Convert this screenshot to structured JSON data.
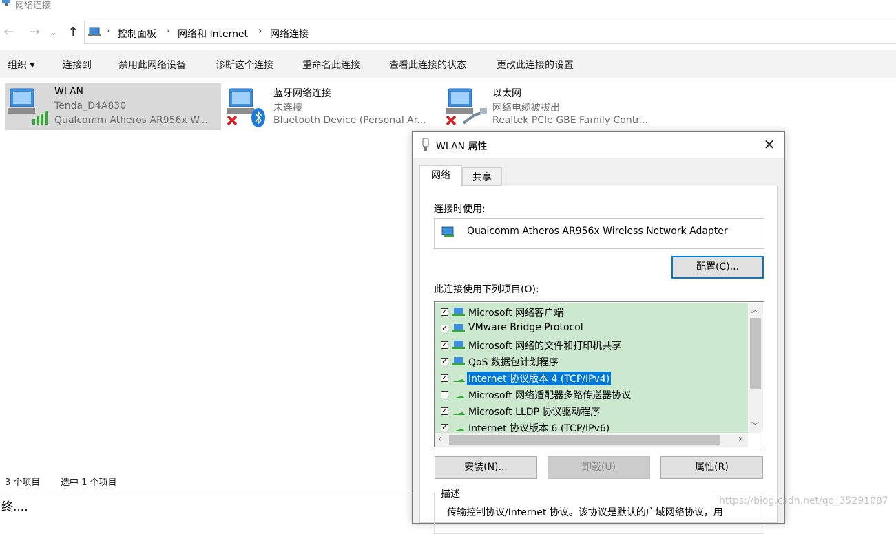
{
  "window": {
    "title": "网络连接"
  },
  "nav": {
    "back": "←",
    "forward": "→",
    "up": "↑"
  },
  "breadcrumb": [
    "控制面板",
    "网络和 Internet",
    "网络连接"
  ],
  "commandbar": {
    "organize": "组织 ▾",
    "connect_to": "连接到",
    "disable": "禁用此网络设备",
    "diagnose": "诊断这个连接",
    "rename": "重命名此连接",
    "view_status": "查看此连接的状态",
    "change_settings": "更改此连接的设置"
  },
  "connections": [
    {
      "name": "WLAN",
      "status": "Tenda_D4A830",
      "device": "Qualcomm Atheros AR956x W...",
      "selected": true,
      "icon": "wifi-signal-icon"
    },
    {
      "name": "蓝牙网络连接",
      "status": "未连接",
      "device": "Bluetooth Device (Personal Ar...",
      "selected": false,
      "icon": "bluetooth-icon"
    },
    {
      "name": "以太网",
      "status": "网络电缆被拔出",
      "device": "Realtek PCIe GBE Family Contr...",
      "selected": false,
      "icon": "ethernet-cable-icon"
    }
  ],
  "statusbar": {
    "count": "3 个项目",
    "selected": "选中 1 个项目"
  },
  "bottom": {
    "text": "终...."
  },
  "dialog": {
    "title": "WLAN 属性",
    "close": "✕",
    "tabs": [
      "网络",
      "共享"
    ],
    "connect_using_label": "连接时使用:",
    "adapter": "Qualcomm Atheros AR956x Wireless Network Adapter",
    "configure_button": "配置(C)...",
    "items_label": "此连接使用下列项目(O):",
    "items": [
      {
        "label": "Microsoft 网络客户端",
        "checked": true,
        "highlight": false,
        "icon": "network-client-icon"
      },
      {
        "label": "VMware Bridge Protocol",
        "checked": true,
        "highlight": false,
        "icon": "network-client-icon"
      },
      {
        "label": "Microsoft 网络的文件和打印机共享",
        "checked": true,
        "highlight": false,
        "icon": "network-client-icon"
      },
      {
        "label": "QoS 数据包计划程序",
        "checked": true,
        "highlight": false,
        "icon": "network-client-icon"
      },
      {
        "label": "Internet 协议版本 4 (TCP/IPv4)",
        "checked": true,
        "highlight": true,
        "icon": "protocol-icon"
      },
      {
        "label": "Microsoft 网络适配器多路传送器协议",
        "checked": false,
        "highlight": false,
        "icon": "protocol-icon"
      },
      {
        "label": "Microsoft LLDP 协议驱动程序",
        "checked": true,
        "highlight": false,
        "icon": "protocol-icon"
      },
      {
        "label": "Internet 协议版本 6 (TCP/IPv6)",
        "checked": true,
        "highlight": false,
        "icon": "protocol-icon"
      }
    ],
    "install_button": "安装(N)...",
    "uninstall_button": "卸载(U)",
    "properties_button": "属性(R)",
    "description_label": "描述",
    "description_text": "传输控制协议/Internet 协议。该协议是默认的广域网络协议，用"
  },
  "watermark": "https://blog.csdn.net/qq_35291087"
}
